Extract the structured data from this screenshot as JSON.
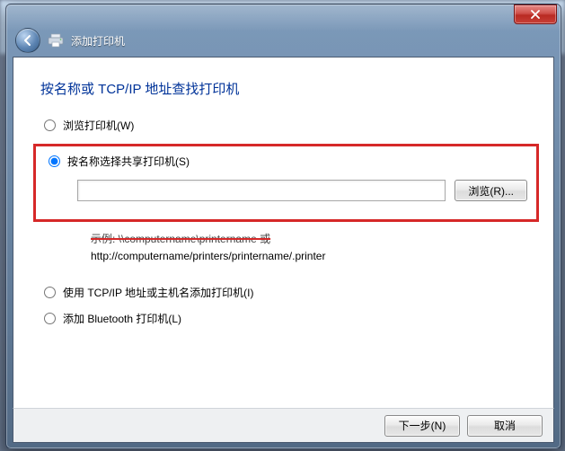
{
  "header": {
    "title": "添加打印机"
  },
  "heading": "按名称或 TCP/IP 地址查找打印机",
  "options": {
    "browse": {
      "label": "浏览打印机(W)"
    },
    "byName": {
      "label": "按名称选择共享打印机(S)"
    },
    "tcpip": {
      "label": "使用 TCP/IP 地址或主机名添加打印机(I)"
    },
    "bluetooth": {
      "label": "添加 Bluetooth 打印机(L)"
    }
  },
  "selected_option": "byName",
  "name_input": {
    "value": "",
    "placeholder": ""
  },
  "browse_button": "浏览(R)...",
  "example": {
    "line1": "示例: \\\\computername\\printername 或",
    "line2": "http://computername/printers/printername/.printer"
  },
  "footer": {
    "next": "下一步(N)",
    "cancel": "取消"
  }
}
